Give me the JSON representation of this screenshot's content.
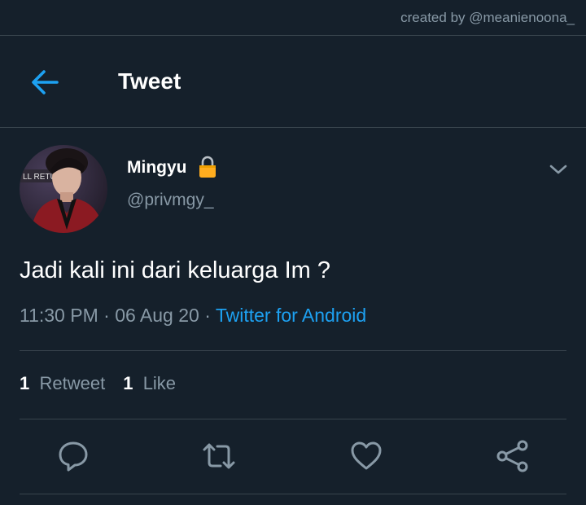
{
  "watermark": "created by @meanienoona_",
  "header": {
    "title": "Tweet",
    "back_icon": "arrow-left-icon"
  },
  "user": {
    "name": "Mingyu",
    "handle": "@privmgy_",
    "lock_icon": "lock-icon",
    "avatar_text": "LL RETU"
  },
  "tweet": {
    "text": "Jadi kali ini dari keluarga Im ?",
    "time": "11:30 PM",
    "sep1": " · ",
    "date": "06 Aug 20",
    "sep2": " · ",
    "source": "Twitter for Android"
  },
  "stats": {
    "retweet_count": "1",
    "retweet_label": "Retweet",
    "like_count": "1",
    "like_label": "Like"
  },
  "actions": [
    "reply-icon",
    "retweet-icon",
    "like-icon",
    "share-icon"
  ],
  "colors": {
    "background": "#15202b",
    "accent": "#1da1f2",
    "secondary_text": "#8899a6",
    "divider": "#38444d",
    "lock": "#ffad1f"
  }
}
